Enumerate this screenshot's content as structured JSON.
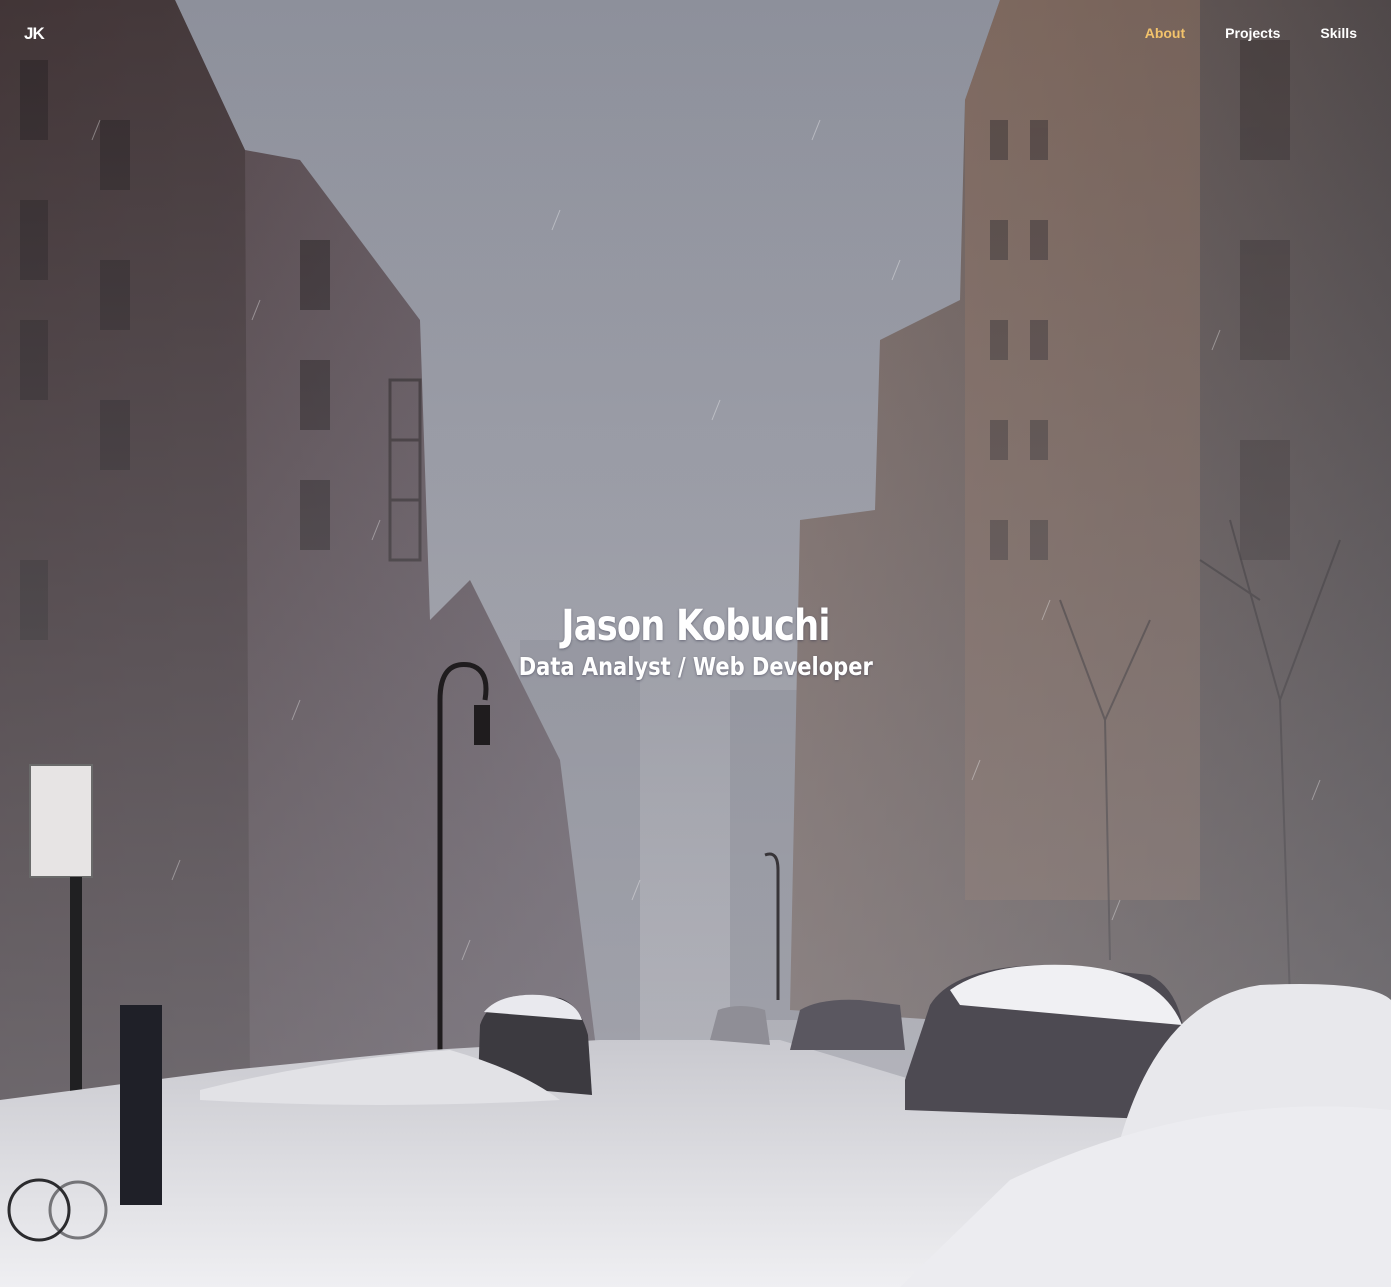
{
  "nav": {
    "brand": "JK",
    "links": [
      {
        "label": "About",
        "active": true
      },
      {
        "label": "Projects",
        "active": false
      },
      {
        "label": "Skills",
        "active": false
      }
    ]
  },
  "hero": {
    "title": "Jason Kobuchi",
    "subtitle": "Data Analyst / Web Developer",
    "background": "snowy-city-street-photo"
  },
  "colors": {
    "nav_active": "#f3c36b",
    "nav_text": "#ffffff",
    "hero_text": "#ffffff"
  }
}
